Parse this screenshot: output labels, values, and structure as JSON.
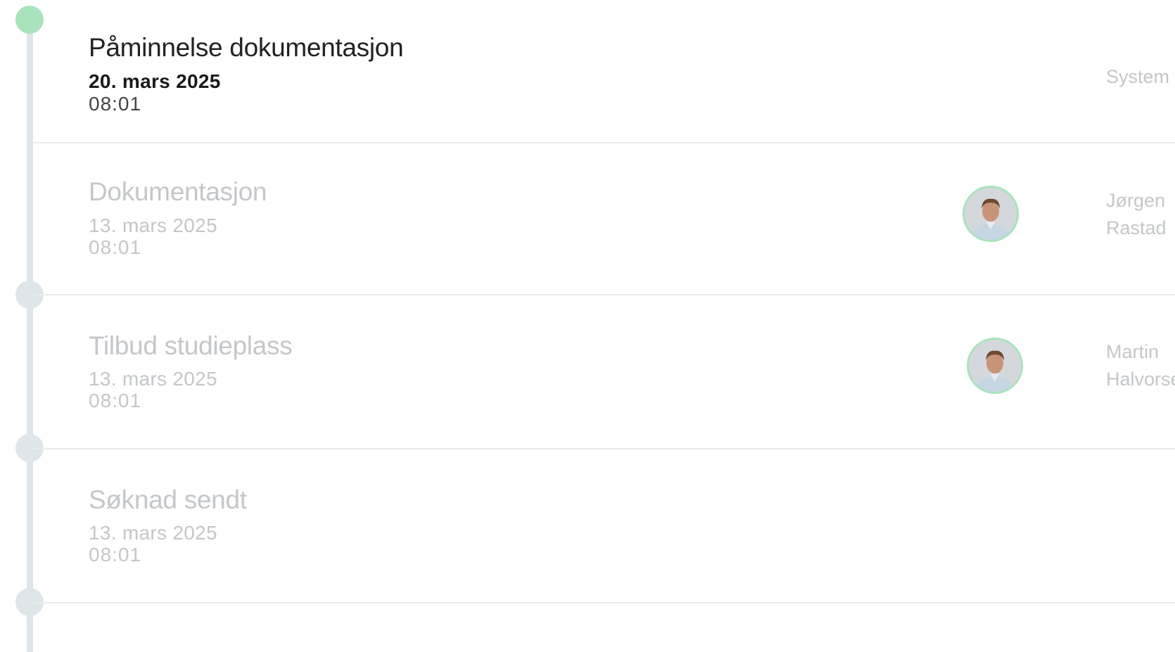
{
  "colors": {
    "timeline_track": "#dfe6ea",
    "active_dot": "#a8e3bd",
    "avatar_border": "#a8e3bd",
    "muted_text": "#c4c7ca",
    "primary_text": "#222222",
    "divider": "#e9ecef"
  },
  "events": [
    {
      "title": "Påminnelse dokumentasjon",
      "date": "20. mars 2025",
      "time": "08:01",
      "actor_line1": "System",
      "actor_line2": "",
      "avatar_icon": "",
      "state": "current"
    },
    {
      "title": "Dokumentasjon",
      "date": "13. mars 2025",
      "time": "08:01",
      "actor_line1": "Jørgen",
      "actor_line2": "Rastad",
      "avatar_icon": "person-photo-avatar",
      "state": "past"
    },
    {
      "title": "Tilbud studieplass",
      "date": "13. mars 2025",
      "time": "08:01",
      "actor_line1": "Martin",
      "actor_line2": "Halvorse",
      "avatar_icon": "person-photo-avatar",
      "state": "past"
    },
    {
      "title": "Søknad sendt",
      "date": "13. mars 2025",
      "time": "08:01",
      "actor_line1": "",
      "actor_line2": "",
      "avatar_icon": "",
      "state": "past"
    }
  ]
}
